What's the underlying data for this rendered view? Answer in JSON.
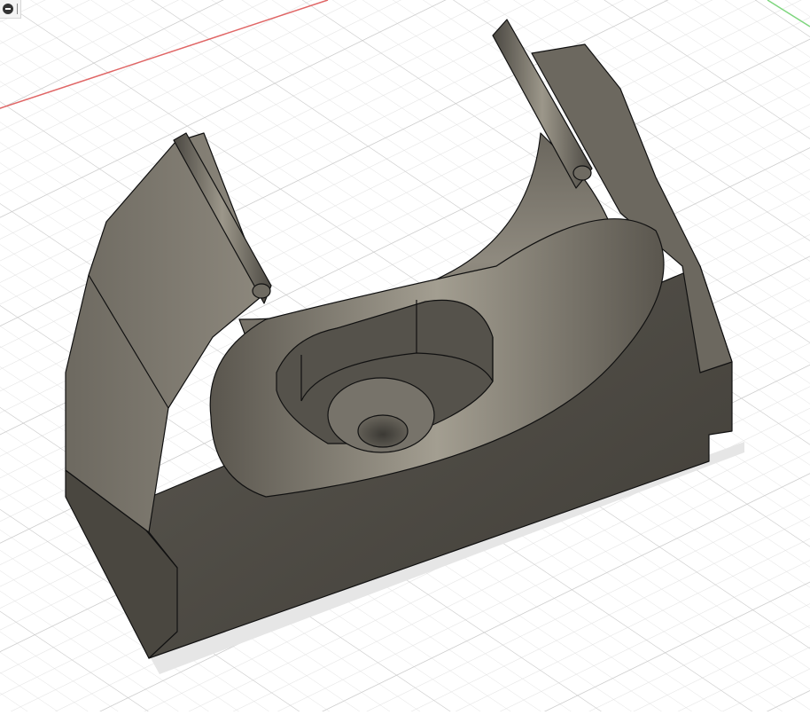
{
  "viewport": {
    "background": "#ffffff",
    "grid_color": "#dcdcdc",
    "grid_major_color": "#c9c9c9",
    "axis_x_color": "#e06666",
    "axis_y_color": "#7ed67e"
  },
  "model": {
    "body_color": "#5f5b52",
    "body_dark": "#45423c",
    "body_light": "#8a857a",
    "edge_color": "#111111"
  },
  "corner_widget": {
    "icon": "collapse-icon"
  }
}
